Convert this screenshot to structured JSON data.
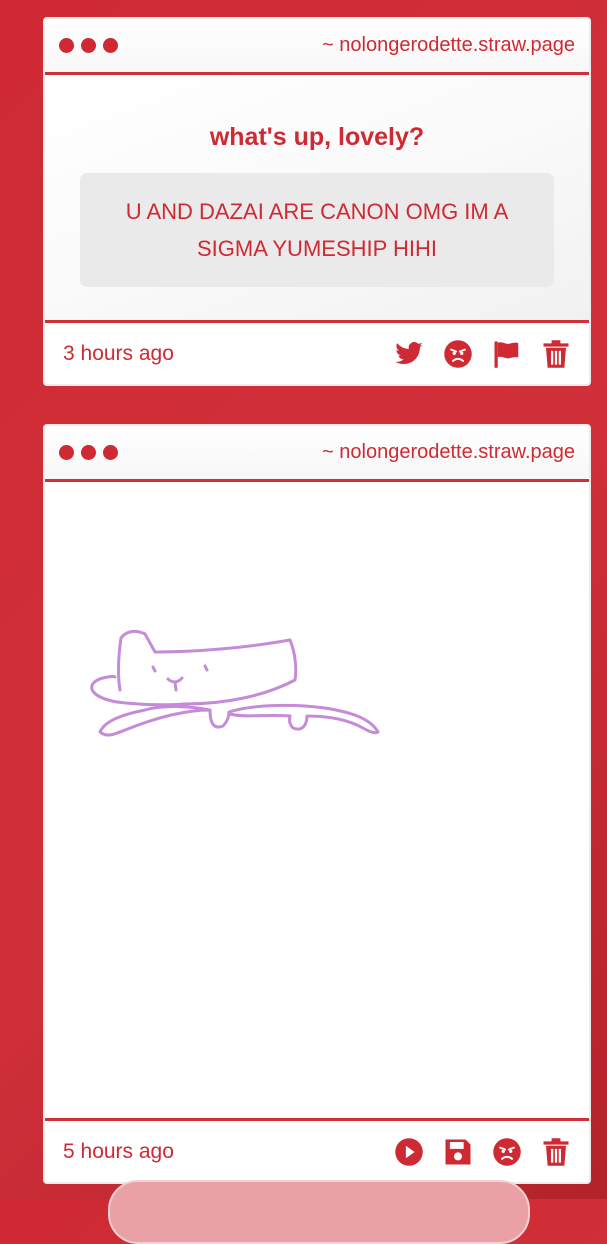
{
  "cards": [
    {
      "url": "~ nolongerodette.straw.page",
      "question": "what's up, lovely?",
      "answer": "U AND DAZAI ARE CANON OMG IM A SIGMA YUMESHIP HIHI",
      "time": "3 hours ago",
      "actions": [
        "twitter-icon",
        "angry-face-icon",
        "flag-icon",
        "trash-icon"
      ]
    },
    {
      "url": "~ nolongerodette.straw.page",
      "drawing": "purple cat doodle",
      "time": "5 hours ago",
      "actions": [
        "play-icon",
        "save-icon",
        "angry-face-icon",
        "trash-icon"
      ]
    }
  ],
  "colors": {
    "accent": "#cf2a33",
    "doodle": "#c68bd8"
  }
}
